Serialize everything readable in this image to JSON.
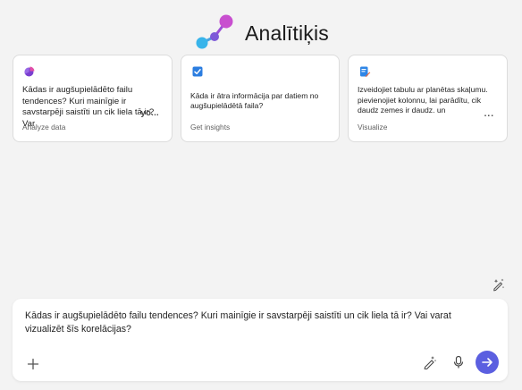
{
  "app": {
    "title": "Analītiķis",
    "accent_color": "#5b5fe0",
    "logo_icon": "molecule-logo-icon"
  },
  "suggestions": [
    {
      "icon": "pie-chart-icon",
      "text": "Kādas ir augšupielādēto failu tendences? Kuri mainīgie ir savstarpēji saistīti un cik liela tā ir? Var",
      "more": "yo...",
      "label": "Analyze data"
    },
    {
      "icon": "checkbox-icon",
      "text": "Kāda ir ātra informācija par datiem no augšupielādētā faila?",
      "label": "Get insights"
    },
    {
      "icon": "document-edit-icon",
      "text": "Izveidojiet tabulu ar planētas skaļumu. pievienojiet kolonnu, lai parādītu, cik daudz zemes ir daudz. un",
      "more": "...",
      "label": "Visualize"
    }
  ],
  "composer": {
    "prompt": "Kādas ir augšupielādēto failu tendences? Kuri mainīgie ir savstarpēji saistīti un cik liela tā ir? Vai varat vizualizēt šīs korelācijas?",
    "add_icon": "plus-icon",
    "prompt_guide_icon": "pen-sparkle-icon",
    "mic_icon": "microphone-icon",
    "send_icon": "arrow-right-icon"
  },
  "sparkle_button_icon": "sparkle-edit-icon"
}
